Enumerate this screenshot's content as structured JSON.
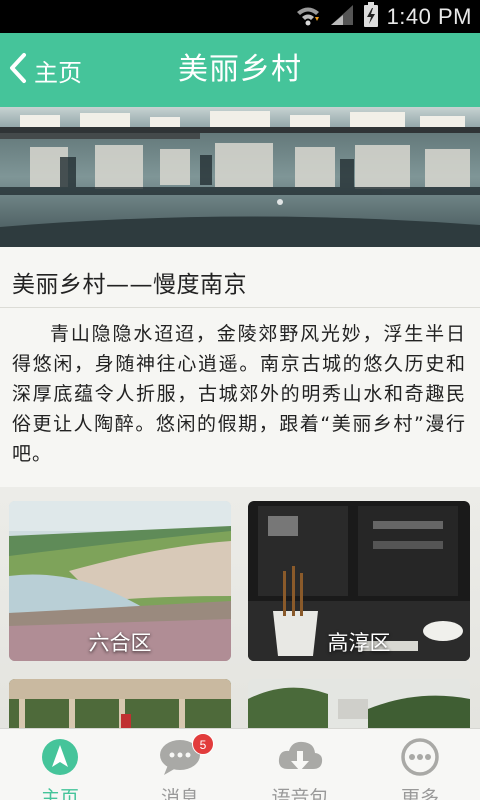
{
  "status_bar": {
    "time": "1:40 PM",
    "icons": [
      "wifi-icon",
      "signal-icon",
      "battery-charging-icon"
    ]
  },
  "header": {
    "back_label": "主页",
    "title": "美丽乡村"
  },
  "article": {
    "title": "美丽乡村——慢度南京",
    "body": "青山隐隐水迢迢，金陵郊野风光妙，浮生半日得悠闲，身随神往心逍遥。南京古城的悠久历史和深厚底蕴令人折服，古城郊外的明秀山水和奇趣民俗更让人陶醉。悠闲的假期，跟着“美丽乡村”漫行吧。"
  },
  "tiles": [
    {
      "label": "六合区"
    },
    {
      "label": "高淳区"
    },
    {
      "label": ""
    },
    {
      "label": ""
    }
  ],
  "bottom_nav": {
    "items": [
      {
        "label": "主页",
        "icon": "navigation-arrow-icon",
        "active": true
      },
      {
        "label": "消息",
        "icon": "chat-bubble-icon",
        "badge": "5"
      },
      {
        "label": "语音包",
        "icon": "cloud-download-icon"
      },
      {
        "label": "更多",
        "icon": "more-dots-icon"
      }
    ]
  },
  "colors": {
    "accent": "#45c49a",
    "badge": "#e23c3c"
  }
}
